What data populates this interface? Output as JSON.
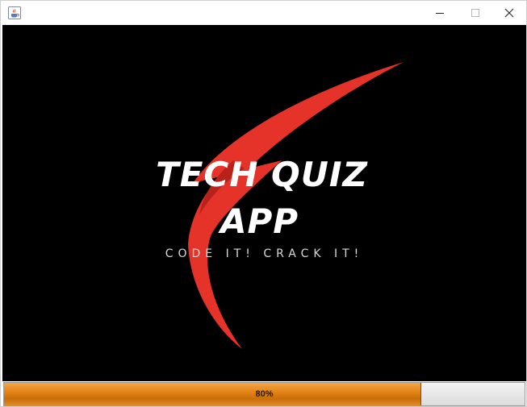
{
  "window": {
    "app_icon": "java-cup-icon",
    "controls": {
      "minimize_icon": "minimize-icon",
      "maximize_icon": "maximize-icon",
      "close_icon": "close-icon"
    }
  },
  "splash": {
    "title_line1": "TECH QUIZ",
    "title_line2": "APP",
    "tagline": "CODE IT! CRACK IT!",
    "logo_icon": "lightning-bolt-icon",
    "colors": {
      "background": "#000000",
      "accent": "#e53329",
      "title_text": "#ffffff"
    }
  },
  "progress": {
    "value": 80,
    "label": "80%",
    "fill_color": "#e8881c"
  }
}
